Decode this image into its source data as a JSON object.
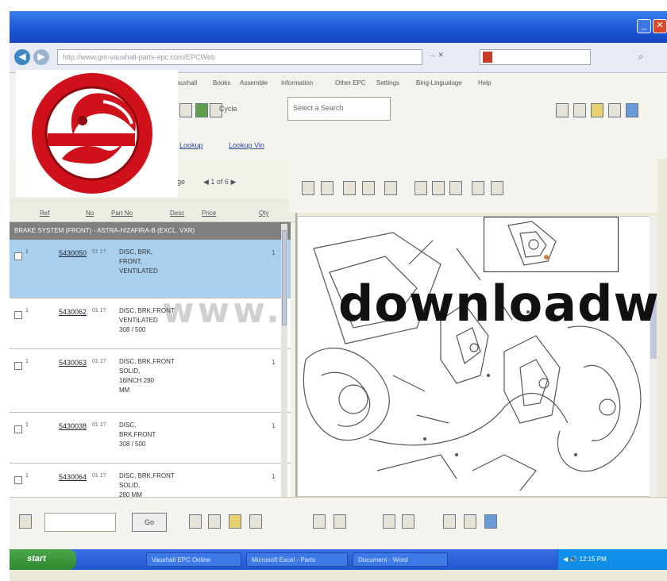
{
  "window": {
    "title": ""
  },
  "address": {
    "url": "http://www.gm-vauxhall-parts-epc.com/EPCWeb",
    "right_text": "→ ✕",
    "search_placeholder": ""
  },
  "menu": [
    "Vauxhall",
    "Books",
    "Assemble",
    "Information",
    "Other EPC",
    "Settings",
    "Bing-Lingualoge",
    "Help"
  ],
  "toolbar": {
    "cycle_label": "Cycle",
    "dropdown_value": "Select a Search"
  },
  "links": [
    "Lookup",
    "Lookup Vin"
  ],
  "pager": {
    "label": "Page",
    "nav": "◀ 1 of 6 ▶"
  },
  "columns": [
    "Ref",
    "No",
    "Part No",
    "Desc",
    "Price",
    "Qty"
  ],
  "group_row": "BRAKE SYSTEM (FRONT) - ASTRA-H/ZAFIRA-B (EXCL. VXR)",
  "parts": [
    {
      "num": "1",
      "code": "5430050",
      "ver": "01 1?",
      "desc": [
        "DISC, BRK,",
        "FRONT,",
        "VENTILATED"
      ],
      "qty": "1",
      "selected": true
    },
    {
      "num": "1",
      "code": "5430062",
      "ver": "01 1?",
      "desc": [
        "DISC, BRK,FRONT",
        "VENTILATED",
        "308 / 500"
      ],
      "qty": "",
      "selected": false
    },
    {
      "num": "1",
      "code": "5430063",
      "ver": "01 1?",
      "desc": [
        "DISC, BRK,FRONT",
        "SOLID,",
        "16INCH 280",
        "MM"
      ],
      "qty": "1",
      "selected": false
    },
    {
      "num": "1",
      "code": "5430038",
      "ver": "01 1?",
      "desc": [
        "DISC,",
        "BRK,FRONT",
        "308 / 500"
      ],
      "qty": "1",
      "selected": false
    },
    {
      "num": "1",
      "code": "5430064",
      "ver": "01 1?",
      "desc": [
        "DISC, BRK,FRONT",
        "SOLID,",
        "280 MM"
      ],
      "qty": "1",
      "selected": false
    }
  ],
  "watermark": {
    "text": "downloadw",
    "prefix": "www."
  },
  "bottom": {
    "go_label": "Go"
  },
  "taskbar": {
    "start_label": "start",
    "tasks": [
      "Vauxhall EPC Online",
      "Microsoft Excel - Parts",
      "Document - Word"
    ],
    "tray_text": "◀ 🔊 12:15 PM"
  },
  "colors": {
    "accent": "#1c56d8",
    "selected_row": "#a9cfee",
    "logo_red": "#d0111b"
  }
}
